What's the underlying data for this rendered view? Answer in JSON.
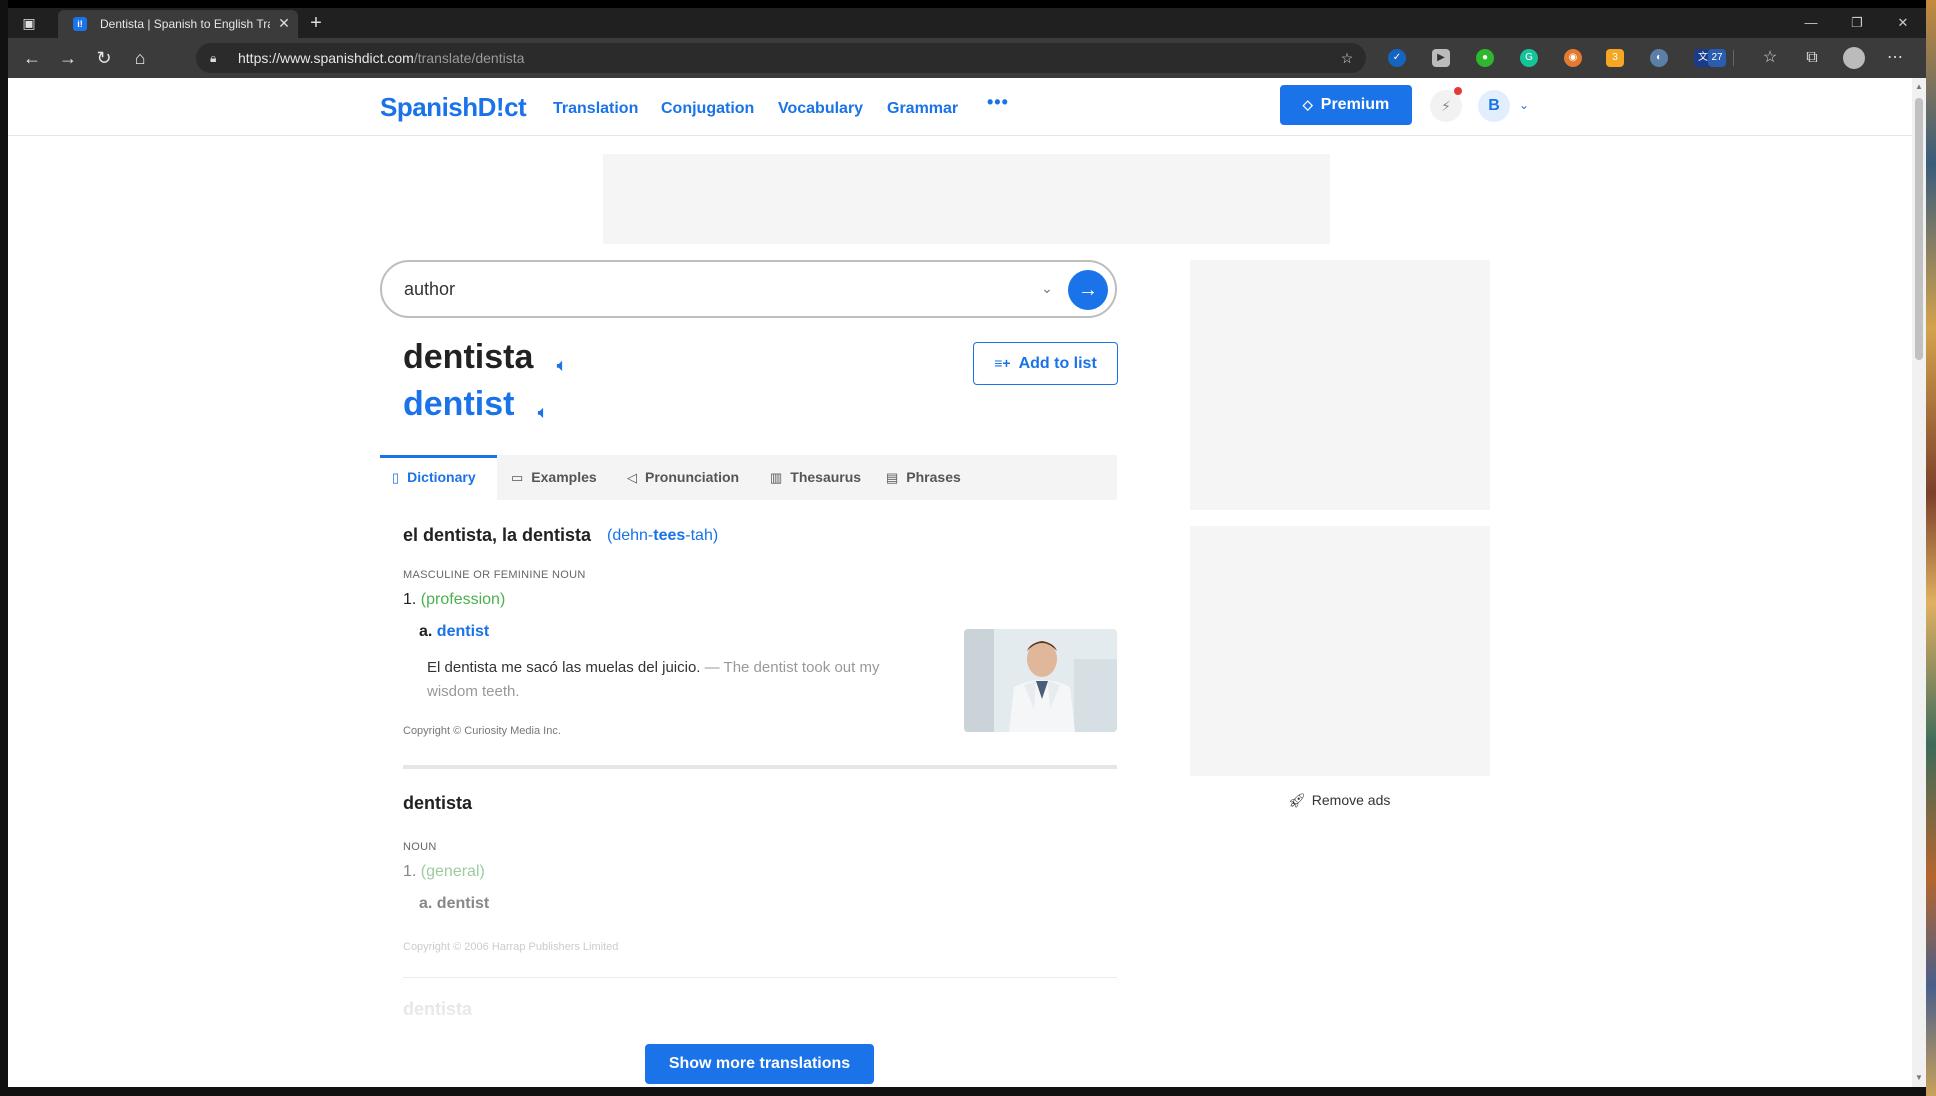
{
  "browser": {
    "tab_title": "Dentista | Spanish to English Tra",
    "tab_favicon_letter": "i!",
    "url_host": "https://www.spanishdict.com",
    "url_path": "/translate/dentista",
    "extension_badges": [
      "3",
      "27"
    ]
  },
  "site": {
    "logo": "SpanishD!ct",
    "nav": [
      "Translation",
      "Conjugation",
      "Vocabulary",
      "Grammar"
    ],
    "more": "•••",
    "premium_label": "Premium",
    "user_initial": "B",
    "remove_ads": "Remove ads"
  },
  "search": {
    "value": "author"
  },
  "word": {
    "headword": "dentista",
    "translation": "dentist",
    "add_to_list": "Add to list"
  },
  "tabs": [
    "Dictionary",
    "Examples",
    "Pronunciation",
    "Thesaurus",
    "Phrases"
  ],
  "entry1": {
    "title": "el dentista, la dentista",
    "pron_pre": "(dehn-",
    "pron_stress": "tees",
    "pron_post": "-tah)",
    "pos": "MASCULINE OR FEMININE NOUN",
    "sense_num": "1.",
    "sense_ctx": "(profession)",
    "sub_letter": "a.",
    "sub_translation": "dentist",
    "example_es": "El dentista me sacó las muelas del juicio.",
    "example_sep": "—",
    "example_en": "The dentist took out my wisdom teeth.",
    "copyright": "Copyright © Curiosity Media Inc."
  },
  "entry2": {
    "title": "dentista",
    "pos": "NOUN",
    "sense_num": "1.",
    "sense_ctx": "(general)",
    "sub_letter": "a.",
    "sub_translation": "dentist",
    "copyright": "Copyright © 2006 Harrap Publishers Limited"
  },
  "entry3": {
    "title": "dentista"
  },
  "show_more": "Show more translations"
}
